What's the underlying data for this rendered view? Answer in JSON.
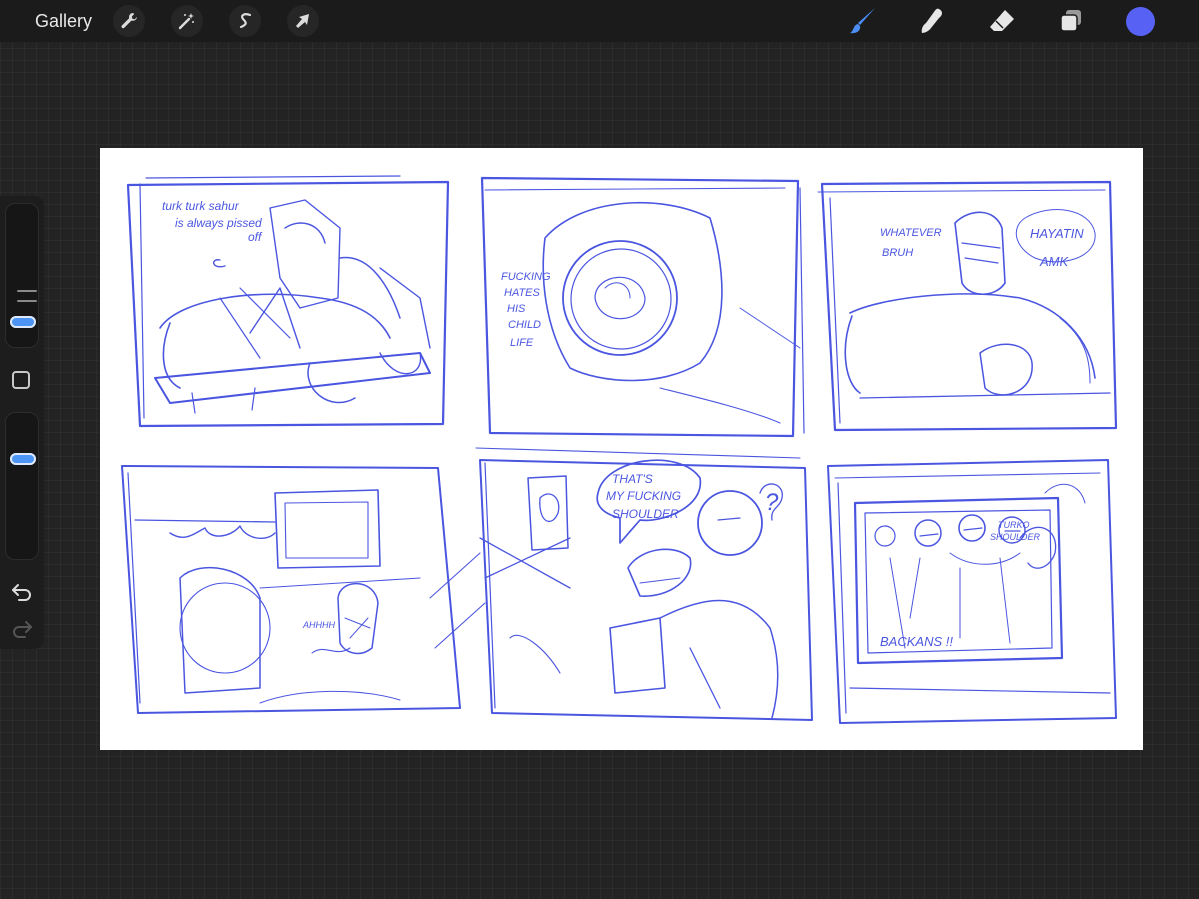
{
  "topbar": {
    "gallery_label": "Gallery",
    "left_tools": [
      {
        "name": "actions",
        "icon": "wrench-icon"
      },
      {
        "name": "adjustments",
        "icon": "magic-wand-icon"
      },
      {
        "name": "selection",
        "icon": "selection-s-icon"
      },
      {
        "name": "transform",
        "icon": "arrow-cursor-icon"
      }
    ],
    "right_tools": [
      {
        "name": "brush",
        "icon": "paintbrush-icon",
        "active": true
      },
      {
        "name": "smudge",
        "icon": "smudge-finger-icon"
      },
      {
        "name": "eraser",
        "icon": "eraser-icon"
      },
      {
        "name": "layers",
        "icon": "layers-icon"
      }
    ],
    "current_color": "#5762f5"
  },
  "sidebar": {
    "brush_size": "upper-slider",
    "opacity": "lower-slider",
    "undo_icon": "undo-icon",
    "redo_icon": "redo-icon"
  },
  "canvas": {
    "ink_color": "#4b56e0",
    "panel1": {
      "line1": "turk turk sahur",
      "line2": "is always pissed",
      "line3": "off"
    },
    "panel2": {
      "line1": "FUCKING",
      "line2": "HATES",
      "line3": "HIS",
      "line4": "CHILD",
      "line5": "LIFE"
    },
    "panel3": {
      "left1": "WHATEVER",
      "left2": "BRUH",
      "right1": "HAYATIN",
      "right2": "AMK"
    },
    "panel4": {
      "label": "AHHHH"
    },
    "panel5": {
      "line1": "THAT'S",
      "line2": "MY FUCKING",
      "line3": "SHOULDER",
      "question": "?"
    },
    "panel6": {
      "tag1": "TURKO",
      "tag2": "SHOULDER",
      "bottom": "BACKANS !!"
    }
  }
}
